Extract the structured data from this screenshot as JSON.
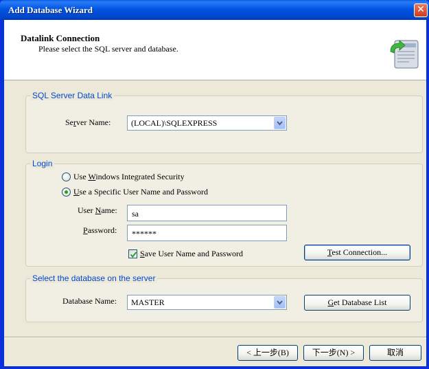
{
  "window": {
    "title": "Add Database Wizard",
    "close_symbol": "✕"
  },
  "header": {
    "title": "Datalink Connection",
    "subtitle": "Please select the SQL server and database.",
    "icon": "database-wizard-icon"
  },
  "datalink": {
    "legend": "SQL Server Data Link",
    "server_label_pre": "Se",
    "server_label_u": "r",
    "server_label_post": "ver Name:",
    "server_value": "(LOCAL)\\SQLEXPRESS"
  },
  "login": {
    "legend": "Login",
    "radio_windows_pre": "Use ",
    "radio_windows_u": "W",
    "radio_windows_post": "indows Integrated Security",
    "radio_specific_u": "U",
    "radio_specific_post": "se a Specific User Name and Password",
    "selected": "specific",
    "user_label_pre": "User ",
    "user_label_u": "N",
    "user_label_post": "ame:",
    "user_value": "sa",
    "password_label_u": "P",
    "password_label_post": "assword:",
    "password_value": "******",
    "save_u": "S",
    "save_post": "ave User Name and Password",
    "save_checked": true,
    "test_u": "T",
    "test_post": "est Connection..."
  },
  "database": {
    "legend": "Select the database on the server",
    "db_label_pre": "Database Name:",
    "db_value": "MASTER",
    "get_list_u": "G",
    "get_list_post": "et Database List"
  },
  "footer": {
    "back_label": "< 上一步(B)",
    "next_label": "下一步(N) >",
    "cancel_label": "取消"
  }
}
